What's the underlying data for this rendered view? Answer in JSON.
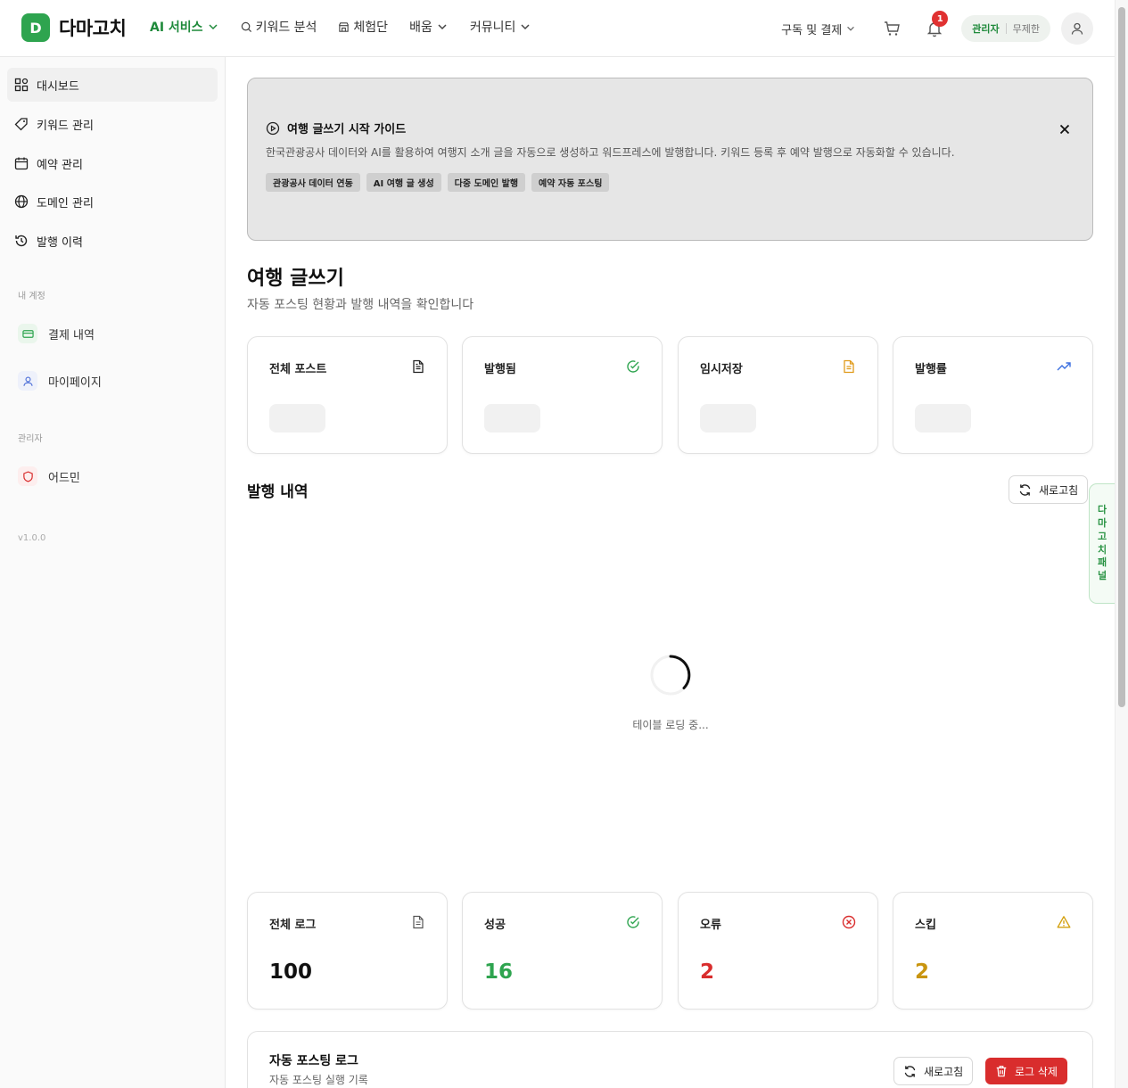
{
  "header": {
    "logo_letter": "D",
    "logo_text": "다마고치",
    "nav": {
      "ai_services": "AI 서비스",
      "keyword_analysis": "키워드 분석",
      "experience": "체험단",
      "learning": "배움",
      "community": "커뮤니티"
    },
    "subscription": "구독 및 결제",
    "notification_count": "1",
    "role": "관리자",
    "plan": "무제한"
  },
  "sidebar": {
    "items": [
      {
        "label": "대시보드",
        "icon": "dashboard-icon"
      },
      {
        "label": "키워드 관리",
        "icon": "tag-icon"
      },
      {
        "label": "예약 관리",
        "icon": "calendar-icon"
      },
      {
        "label": "도메인 관리",
        "icon": "globe-icon"
      },
      {
        "label": "발행 이력",
        "icon": "history-icon"
      }
    ],
    "account_section": "내 계정",
    "account_items": [
      {
        "label": "결제 내역",
        "icon": "card-icon"
      },
      {
        "label": "마이페이지",
        "icon": "user-icon"
      }
    ],
    "admin_section": "관리자",
    "admin_items": [
      {
        "label": "어드민",
        "icon": "shield-icon"
      }
    ],
    "version": "v1.0.0"
  },
  "guide": {
    "title": "여행 글쓰기 시작 가이드",
    "description": "한국관광공사 데이터와 AI를 활용하여 여행지 소개 글을 자동으로 생성하고 워드프레스에 발행합니다. 키워드 등록 후 예약 발행으로 자동화할 수 있습니다.",
    "tags": [
      "관광공사 데이터 연동",
      "AI 여행 글 생성",
      "다중 도메인 발행",
      "예약 자동 포스팅"
    ]
  },
  "page": {
    "title": "여행 글쓰기",
    "subtitle": "자동 포스팅 현황과 발행 내역을 확인합니다"
  },
  "post_stats": [
    {
      "label": "전체 포스트",
      "icon": "document-icon",
      "color": "#333333"
    },
    {
      "label": "발행됨",
      "icon": "check-circle-icon",
      "color": "#2ea44f"
    },
    {
      "label": "임시저장",
      "icon": "draft-icon",
      "color": "#e09a1a"
    },
    {
      "label": "발행률",
      "icon": "trending-up-icon",
      "color": "#3b6fe0"
    }
  ],
  "publish_history": {
    "title": "발행 내역",
    "refresh": "새로고침",
    "loading": "테이블 로딩 중..."
  },
  "log_stats": [
    {
      "label": "전체 로그",
      "value": "100",
      "color": "#111111",
      "icon": "document-icon"
    },
    {
      "label": "성공",
      "value": "16",
      "color": "#2ea44f",
      "icon": "check-circle-icon"
    },
    {
      "label": "오류",
      "value": "2",
      "color": "#d92d2d",
      "icon": "x-circle-icon"
    },
    {
      "label": "스킵",
      "value": "2",
      "color": "#c9950f",
      "icon": "warning-icon"
    }
  ],
  "side_panel": {
    "chars": [
      "다",
      "마",
      "고",
      "치",
      "패",
      "널"
    ]
  },
  "log_panel": {
    "title": "자동 포스팅 로그",
    "subtitle": "자동 포스팅 실행 기록",
    "refresh": "새로고침",
    "delete": "로그 삭제"
  }
}
